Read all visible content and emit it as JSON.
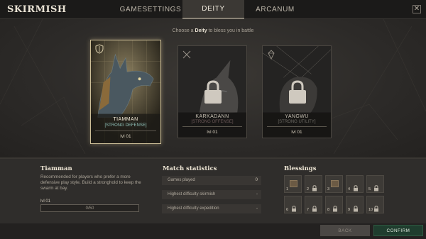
{
  "header": {
    "title": "SKIRMISH",
    "tabs": [
      {
        "label": "GAMESETTINGS",
        "active": false
      },
      {
        "label": "DEITY",
        "active": true
      },
      {
        "label": "ARCANUM",
        "active": false
      }
    ],
    "close_icon": "close-icon"
  },
  "subtitle": {
    "prefix": "Choose a ",
    "emphasis": "Deity",
    "suffix": " to bless you in battle"
  },
  "deities": [
    {
      "name": "TIAMMAN",
      "tag": "[STRONG DEFENSE]",
      "level": "lvl 01",
      "locked": false,
      "selected": true,
      "icon": "shield-icon"
    },
    {
      "name": "KARKADANN",
      "tag": "[STRONG OFFENSE]",
      "level": "lvl 01",
      "locked": true,
      "selected": false,
      "icon": "crossed-swords-icon"
    },
    {
      "name": "YANGWU",
      "tag": "[STRONG UTILITY]",
      "level": "lvl 01",
      "locked": true,
      "selected": false,
      "icon": "gem-icon"
    }
  ],
  "info": {
    "title": "Tiamman",
    "description": "Recommended for players who prefer a more defensive play style. Build a stronghold to keep the swarm at bay.",
    "level_label": "lvl 01",
    "xp_text": "0/50",
    "xp_progress": 0
  },
  "stats": {
    "title": "Match statistics",
    "rows": [
      {
        "label": "Games played",
        "value": "0"
      },
      {
        "label": "Highest difficulty skirmish",
        "value": "-"
      },
      {
        "label": "Highest difficulty expedition",
        "value": "-"
      }
    ]
  },
  "blessings": {
    "title": "Blessings",
    "slots": [
      {
        "num": "1",
        "locked": false
      },
      {
        "num": "2",
        "locked": true
      },
      {
        "num": "3",
        "locked": false
      },
      {
        "num": "4",
        "locked": true
      },
      {
        "num": "5",
        "locked": true
      },
      {
        "num": "6",
        "locked": true
      },
      {
        "num": "7",
        "locked": true
      },
      {
        "num": "8",
        "locked": true
      },
      {
        "num": "9",
        "locked": true
      },
      {
        "num": "10",
        "locked": true
      }
    ]
  },
  "footer": {
    "back_label": "BACK",
    "confirm_label": "CONFIRM"
  },
  "colors": {
    "accent_confirm": "#1f3d2e",
    "defense_tag": "#8fc1b8",
    "selected_border": "#cdbf98"
  }
}
